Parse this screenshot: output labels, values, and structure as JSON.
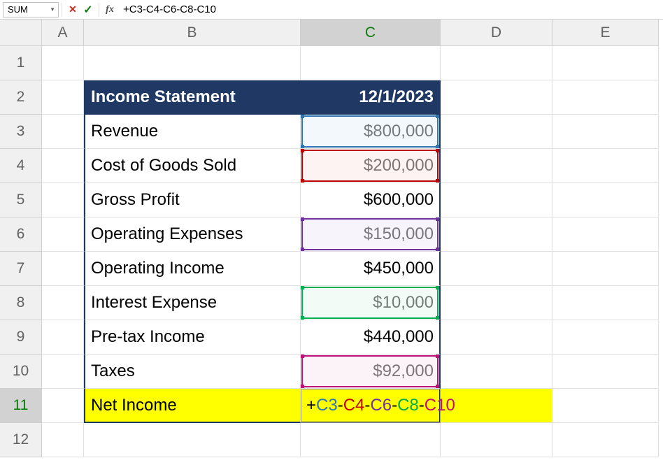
{
  "formulaBar": {
    "nameBox": "SUM",
    "formula": "+C3-C4-C6-C8-C10"
  },
  "columns": [
    "A",
    "B",
    "C",
    "D",
    "E"
  ],
  "rows": [
    "1",
    "2",
    "3",
    "4",
    "5",
    "6",
    "7",
    "8",
    "9",
    "10",
    "11",
    "12"
  ],
  "table": {
    "header": {
      "title": "Income Statement",
      "date": "12/1/2023"
    },
    "rows": [
      {
        "label": "Revenue",
        "value": "$800,000",
        "ref": "C3",
        "refColor": "#2e75b6",
        "refFill": "#e8f1fb"
      },
      {
        "label": "Cost of Goods Sold",
        "value": "$200,000",
        "ref": "C4",
        "refColor": "#c00000",
        "refFill": "#fce8e8"
      },
      {
        "label": "Gross Profit",
        "value": "$600,000"
      },
      {
        "label": "Operating Expenses",
        "value": "$150,000",
        "ref": "C6",
        "refColor": "#7030a0",
        "refFill": "#f2eaf7"
      },
      {
        "label": "Operating Income",
        "value": "$450,000"
      },
      {
        "label": "Interest Expense",
        "value": "$10,000",
        "ref": "C8",
        "refColor": "#00b050",
        "refFill": "#e6f7ec"
      },
      {
        "label": "Pre-tax Income",
        "value": "$440,000"
      },
      {
        "label": "Taxes",
        "value": "$92,000",
        "ref": "C10",
        "refColor": "#bf1077",
        "refFill": "#fae8f2"
      },
      {
        "label": "Net Income",
        "formula": {
          "parts": [
            "+",
            "C3",
            "-",
            "C4",
            "-",
            "C6",
            "-",
            "C8",
            "-",
            "C10"
          ],
          "classes": [
            "fp-black",
            "fp-c3",
            "fp-black",
            "fp-c4",
            "fp-black",
            "fp-c6",
            "fp-black",
            "fp-c8",
            "fp-black",
            "fp-c10"
          ]
        },
        "highlight": true
      }
    ]
  },
  "icons": {
    "cancel": "✕",
    "enter": "✓",
    "fx": "fx",
    "dropdown": "▼"
  }
}
